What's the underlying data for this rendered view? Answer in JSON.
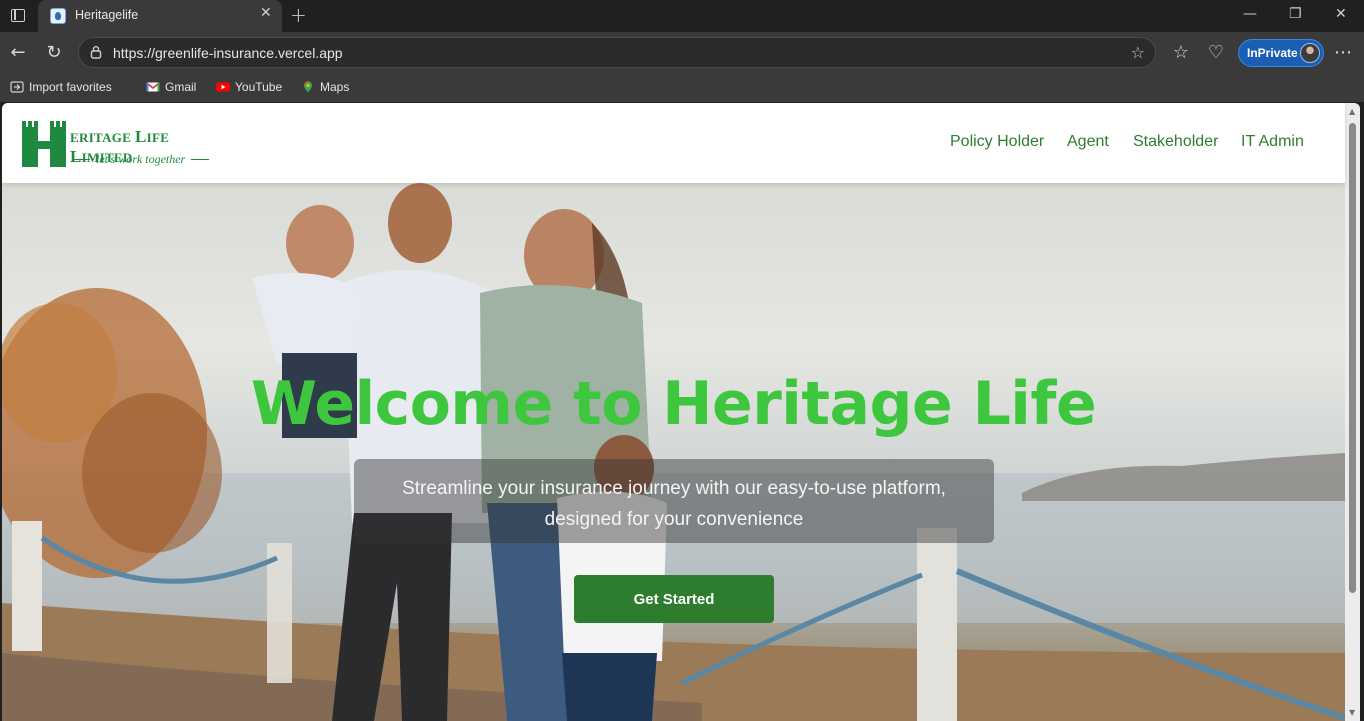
{
  "browser": {
    "tab_title": "Heritagelife",
    "url": "https://greenlife-insurance.vercel.app",
    "inprivate_label": "InPrivate",
    "bookmarks": [
      {
        "label": "Import favorites",
        "icon": "import-icon"
      },
      {
        "label": "Gmail",
        "icon": "gmail-icon"
      },
      {
        "label": "YouTube",
        "icon": "youtube-icon"
      },
      {
        "label": "Maps",
        "icon": "maps-icon"
      }
    ]
  },
  "site": {
    "logo": {
      "name_initial": "H",
      "name_rest": "eritage Life Limited",
      "tagline": "let's work together"
    },
    "nav": [
      "Policy Holder",
      "Agent",
      "Stakeholder",
      "IT Admin"
    ],
    "hero": {
      "title": "Welcome to Heritage Life",
      "subtitle_line1": "Streamline your insurance journey with our easy-to-use platform,",
      "subtitle_line2": "designed for your convenience",
      "cta_label": "Get Started"
    },
    "colors": {
      "brand_green": "#1f8a3f",
      "title_green": "#3ec73e",
      "button_green": "#2e7d2e"
    }
  }
}
